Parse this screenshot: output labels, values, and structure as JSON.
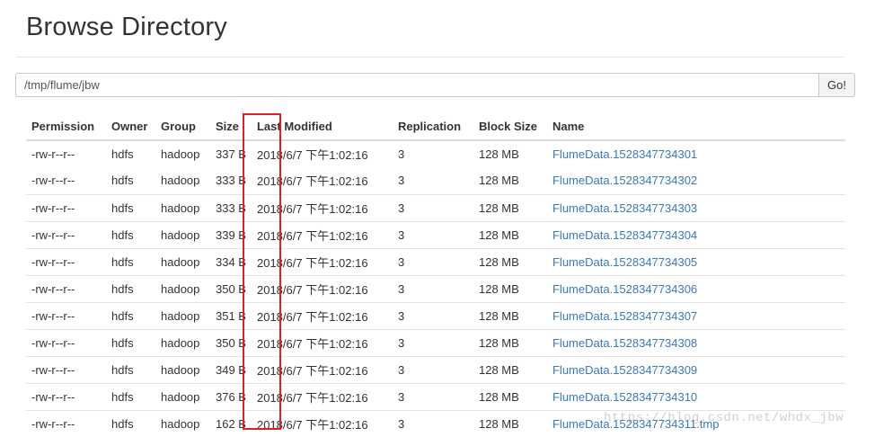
{
  "page": {
    "title": "Browse Directory"
  },
  "path_bar": {
    "value": "/tmp/flume/jbw",
    "go_label": "Go!"
  },
  "table": {
    "headers": [
      "Permission",
      "Owner",
      "Group",
      "Size",
      "Last Modified",
      "Replication",
      "Block Size",
      "Name"
    ],
    "rows": [
      {
        "permission": "-rw-r--r--",
        "owner": "hdfs",
        "group": "hadoop",
        "size": "337 B",
        "last_modified": "2018/6/7 下午1:02:16",
        "replication": "3",
        "block_size": "128 MB",
        "name": "FlumeData.1528347734301"
      },
      {
        "permission": "-rw-r--r--",
        "owner": "hdfs",
        "group": "hadoop",
        "size": "333 B",
        "last_modified": "2018/6/7 下午1:02:16",
        "replication": "3",
        "block_size": "128 MB",
        "name": "FlumeData.1528347734302"
      },
      {
        "permission": "-rw-r--r--",
        "owner": "hdfs",
        "group": "hadoop",
        "size": "333 B",
        "last_modified": "2018/6/7 下午1:02:16",
        "replication": "3",
        "block_size": "128 MB",
        "name": "FlumeData.1528347734303"
      },
      {
        "permission": "-rw-r--r--",
        "owner": "hdfs",
        "group": "hadoop",
        "size": "339 B",
        "last_modified": "2018/6/7 下午1:02:16",
        "replication": "3",
        "block_size": "128 MB",
        "name": "FlumeData.1528347734304"
      },
      {
        "permission": "-rw-r--r--",
        "owner": "hdfs",
        "group": "hadoop",
        "size": "334 B",
        "last_modified": "2018/6/7 下午1:02:16",
        "replication": "3",
        "block_size": "128 MB",
        "name": "FlumeData.1528347734305"
      },
      {
        "permission": "-rw-r--r--",
        "owner": "hdfs",
        "group": "hadoop",
        "size": "350 B",
        "last_modified": "2018/6/7 下午1:02:16",
        "replication": "3",
        "block_size": "128 MB",
        "name": "FlumeData.1528347734306"
      },
      {
        "permission": "-rw-r--r--",
        "owner": "hdfs",
        "group": "hadoop",
        "size": "351 B",
        "last_modified": "2018/6/7 下午1:02:16",
        "replication": "3",
        "block_size": "128 MB",
        "name": "FlumeData.1528347734307"
      },
      {
        "permission": "-rw-r--r--",
        "owner": "hdfs",
        "group": "hadoop",
        "size": "350 B",
        "last_modified": "2018/6/7 下午1:02:16",
        "replication": "3",
        "block_size": "128 MB",
        "name": "FlumeData.1528347734308"
      },
      {
        "permission": "-rw-r--r--",
        "owner": "hdfs",
        "group": "hadoop",
        "size": "349 B",
        "last_modified": "2018/6/7 下午1:02:16",
        "replication": "3",
        "block_size": "128 MB",
        "name": "FlumeData.1528347734309"
      },
      {
        "permission": "-rw-r--r--",
        "owner": "hdfs",
        "group": "hadoop",
        "size": "376 B",
        "last_modified": "2018/6/7 下午1:02:16",
        "replication": "3",
        "block_size": "128 MB",
        "name": "FlumeData.1528347734310"
      },
      {
        "permission": "-rw-r--r--",
        "owner": "hdfs",
        "group": "hadoop",
        "size": "162 B",
        "last_modified": "2018/6/7 下午1:02:16",
        "replication": "3",
        "block_size": "128 MB",
        "name": "FlumeData.1528347734311.tmp"
      }
    ]
  },
  "watermark": {
    "text": "https://blog.csdn.net/whdx_jbw"
  },
  "colors": {
    "link": "#3a78b8",
    "highlight_border": "#e02020"
  }
}
